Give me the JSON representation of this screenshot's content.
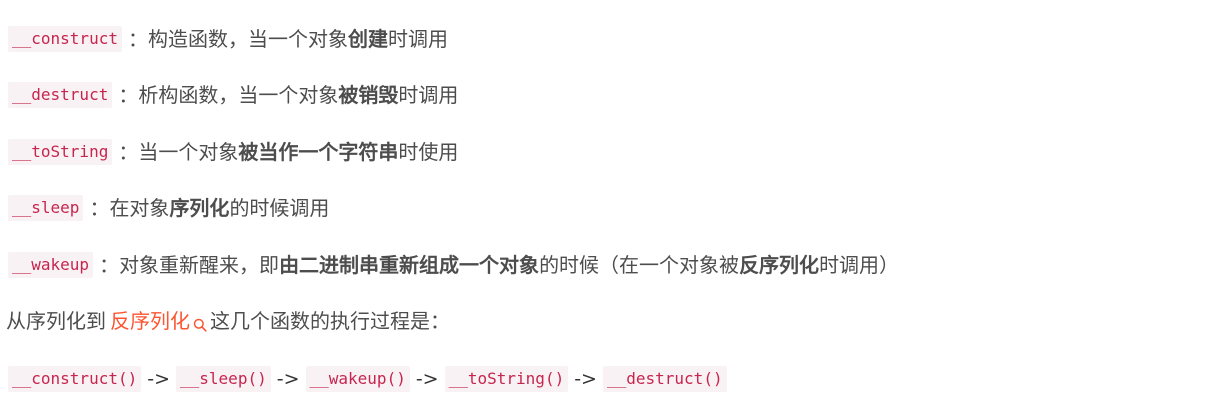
{
  "definitions": [
    {
      "code": "__construct",
      "colon": "：",
      "text_before": "构造函数，当一个对象",
      "bold": "创建",
      "text_after": "时调用"
    },
    {
      "code": "__destruct",
      "colon": "：",
      "text_before": "析构函数，当一个对象",
      "bold": "被销毁",
      "text_after": "时调用"
    },
    {
      "code": "__toString",
      "colon": "：",
      "text_before": "当一个对象",
      "bold": "被当作一个字符串",
      "text_after": "时使用"
    },
    {
      "code": "__sleep",
      "colon": "：",
      "text_before": "在对象",
      "bold": "序列化",
      "text_after": "的时候调用"
    },
    {
      "code": "__wakeup",
      "colon": "：",
      "text_before": "对象重新醒来，即",
      "bold": "由二进制串重新组成一个对象",
      "text_middle": "的时候（在一个对象被",
      "bold2": "反序列化",
      "text_after": "时调用）"
    }
  ],
  "order_sentence": {
    "prefix": "从序列化到",
    "link": "反序列化",
    "suffix": "这几个函数的执行过程是："
  },
  "sequence": {
    "steps": [
      "__construct()",
      "__sleep()",
      "__wakeup()",
      "__toString()",
      "__destruct()"
    ],
    "arrow": "->"
  },
  "icons": {
    "search": "search-icon"
  },
  "colors": {
    "code_text": "#c7254e",
    "code_bg": "#f9f2f4",
    "body_text": "#4d4d4d",
    "link": "#fc5531"
  }
}
